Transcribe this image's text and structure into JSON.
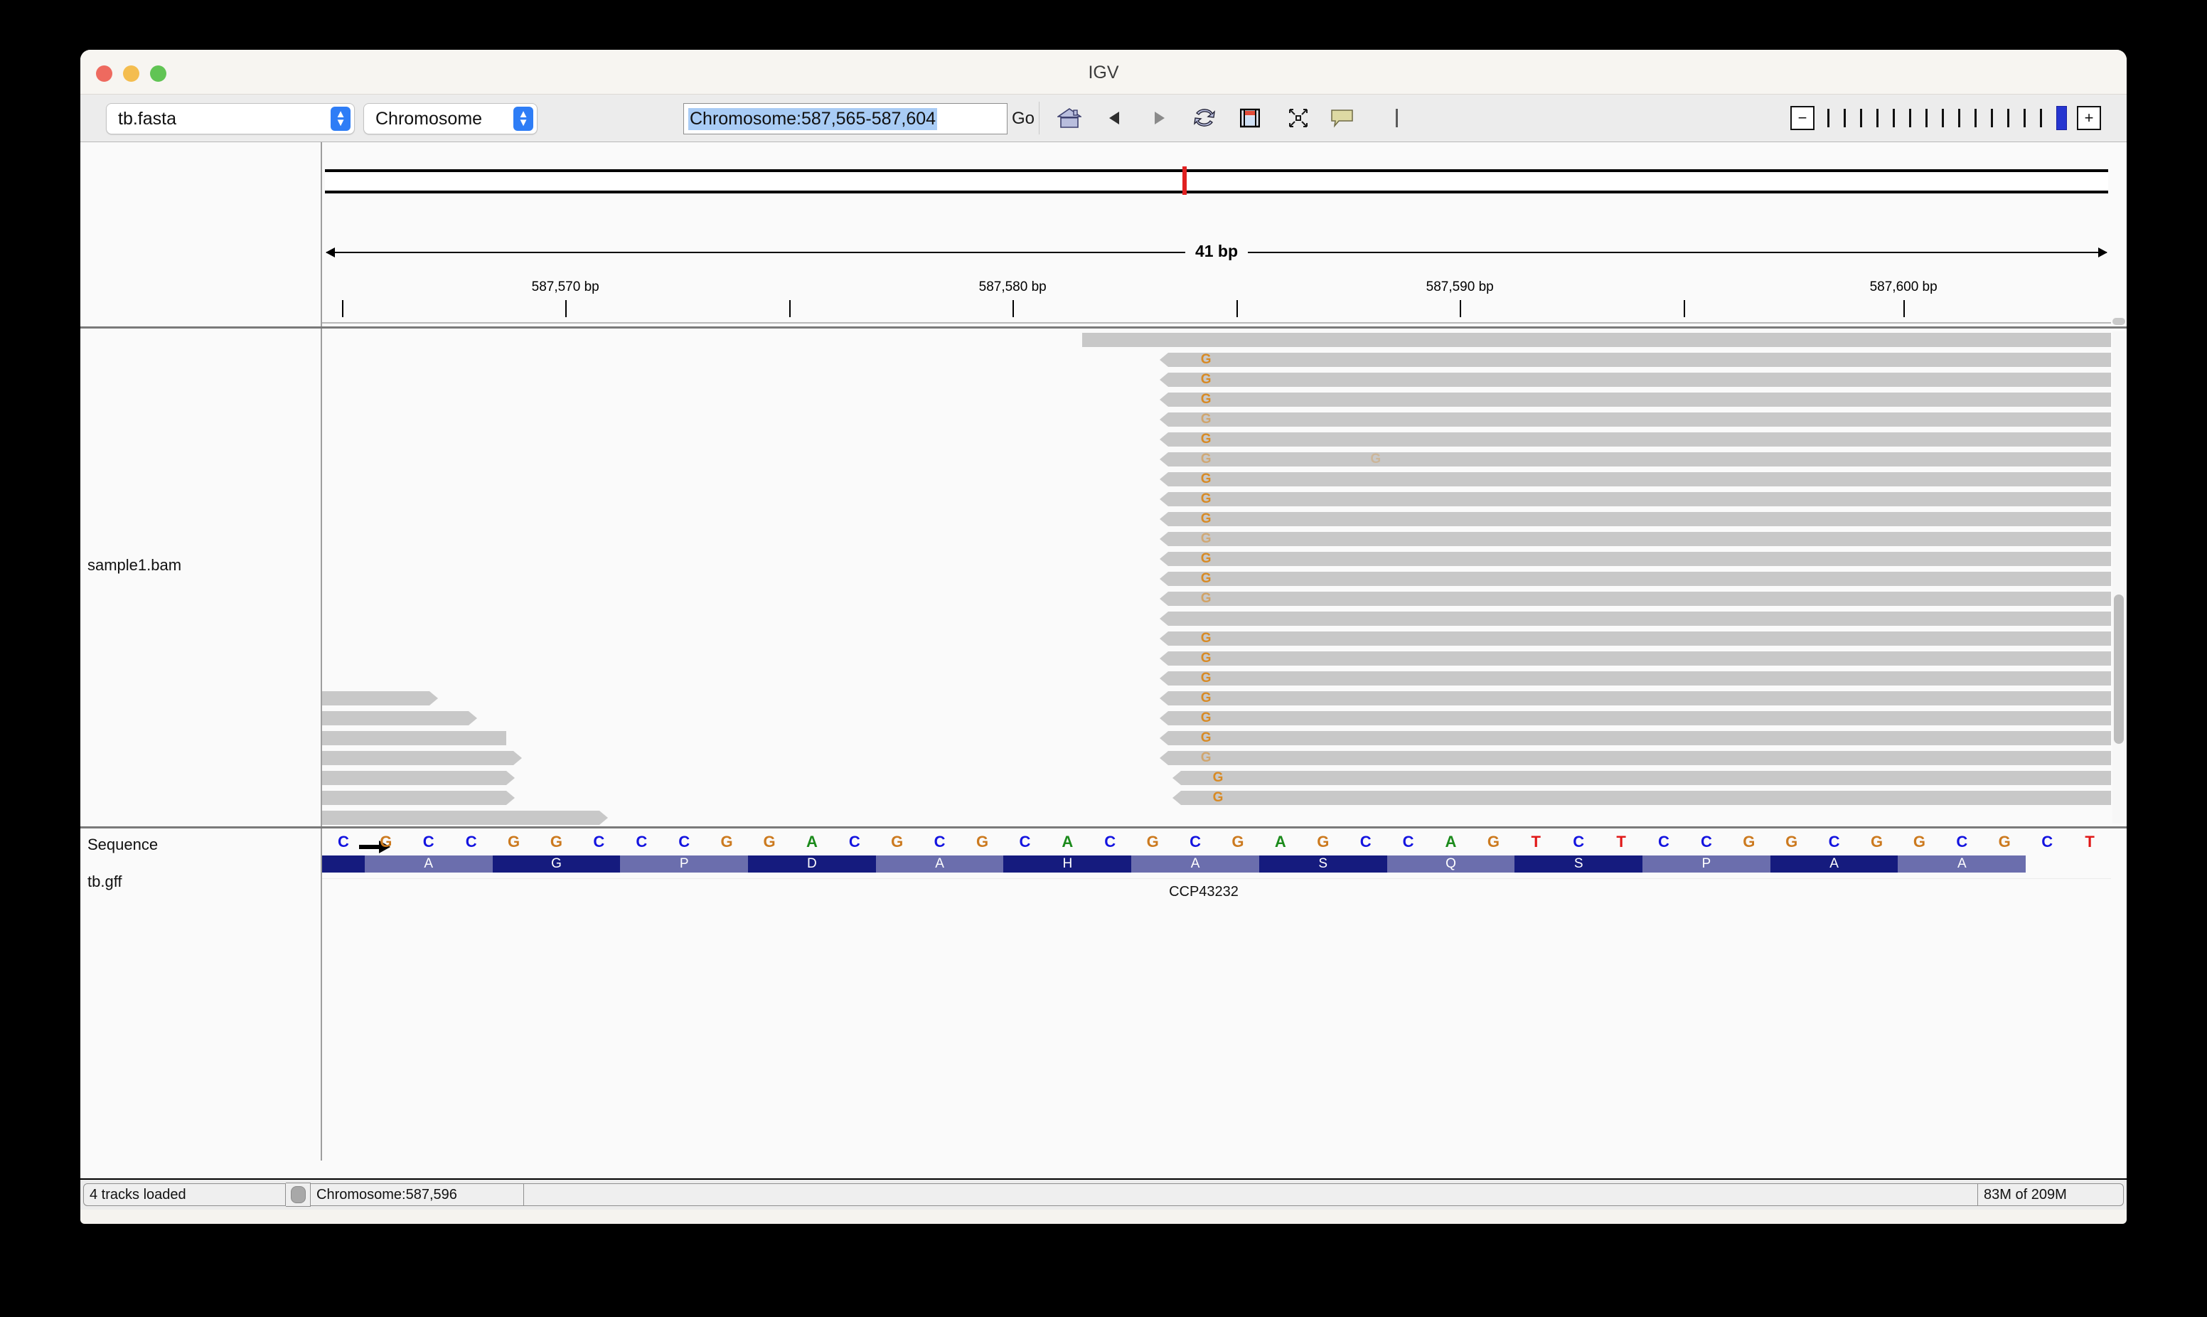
{
  "window": {
    "title": "IGV",
    "traffic_lights": [
      "close",
      "minimize",
      "maximize"
    ]
  },
  "toolbar": {
    "genome_select": "tb.fasta",
    "chromosome_select": "Chromosome",
    "locus_value": "Chromosome:587,565-587,604",
    "locus_placeholder": "Chromosome:587,565-587,604",
    "go_label": "Go",
    "icons": [
      "home-icon",
      "back-arrow-icon",
      "forward-arrow-icon",
      "refresh-icon",
      "region-navigator-icon",
      "fit-to-window-icon",
      "popup-behavior-icon",
      "separator-icon"
    ],
    "zoom": {
      "minus_label": "−",
      "plus_label": "+",
      "tick_count": 15,
      "active_tick": 15,
      "active_color": "#2535d0"
    }
  },
  "ruler": {
    "span_label": "41 bp",
    "ideogram_marker_color": "#e02020",
    "tick_labels": [
      {
        "text": "587,570 bp",
        "pct": 13.6
      },
      {
        "text": "587,580 bp",
        "pct": 38.6
      },
      {
        "text": "587,590 bp",
        "pct": 63.6
      },
      {
        "text": "587,600 bp",
        "pct": 88.4
      }
    ],
    "tick_marks_pct": [
      1.1,
      13.6,
      26.1,
      38.6,
      51.1,
      63.6,
      76.1,
      88.4
    ]
  },
  "alignment_track": {
    "name": "sample1.bam",
    "read_color": "#c8c8c8",
    "mismatch_color": "#d88a24",
    "mismatch_base": "G"
  },
  "sequence_track": {
    "name": "Sequence",
    "strand_arrow": "➡",
    "bases": [
      "C",
      "G",
      "C",
      "C",
      "G",
      "G",
      "C",
      "C",
      "C",
      "G",
      "G",
      "A",
      "C",
      "G",
      "C",
      "G",
      "C",
      "A",
      "C",
      "G",
      "C",
      "G",
      "A",
      "G",
      "C",
      "C",
      "A",
      "G",
      "T",
      "C",
      "T",
      "C",
      "C",
      "G",
      "G",
      "C",
      "G",
      "G",
      "C",
      "G",
      "C",
      "T"
    ],
    "base_colors": {
      "A": "#1b8a1b",
      "C": "#1414e0",
      "G": "#cc7a1f",
      "T": "#e01717"
    }
  },
  "gff_track": {
    "name": "tb.gff",
    "gene_name": "CCP43232",
    "amino_acids": [
      "",
      "A",
      "G",
      "P",
      "D",
      "A",
      "H",
      "A",
      "S",
      "Q",
      "S",
      "P",
      "A",
      "A"
    ],
    "block_dark_color": "#151b7e",
    "block_light_color": "#6b6ead"
  },
  "status_bar": {
    "tracks_loaded": "4 tracks loaded",
    "locus": "Chromosome:587,596",
    "memory": "83M of 209M"
  }
}
